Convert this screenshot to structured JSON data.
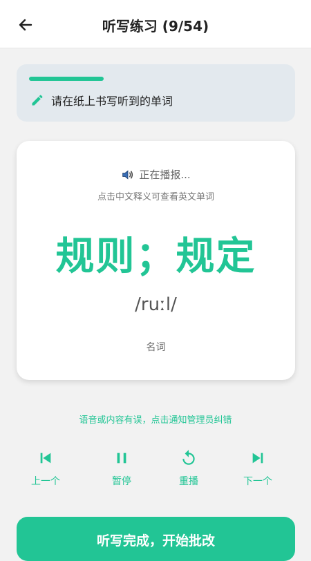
{
  "header": {
    "title": "听写练习 (9/54)"
  },
  "progress": {
    "fraction": 0.3
  },
  "tip": {
    "text": "请在纸上书写听到的单词"
  },
  "word_card": {
    "status": "正在播报...",
    "hint": "点击中文释义可查看英文单词",
    "meaning": "规则；规定",
    "phonetic": "/ruːl/",
    "part_of_speech": "名词"
  },
  "report": {
    "text": "语音或内容有误，点击通知管理员纠错"
  },
  "controls": {
    "prev_label": "上一个",
    "pause_label": "暂停",
    "replay_label": "重播",
    "next_label": "下一个"
  },
  "finish": {
    "label": "听写完成，开始批改"
  },
  "colors": {
    "accent": "#22c595",
    "tip_bg": "#e3e9ee"
  }
}
